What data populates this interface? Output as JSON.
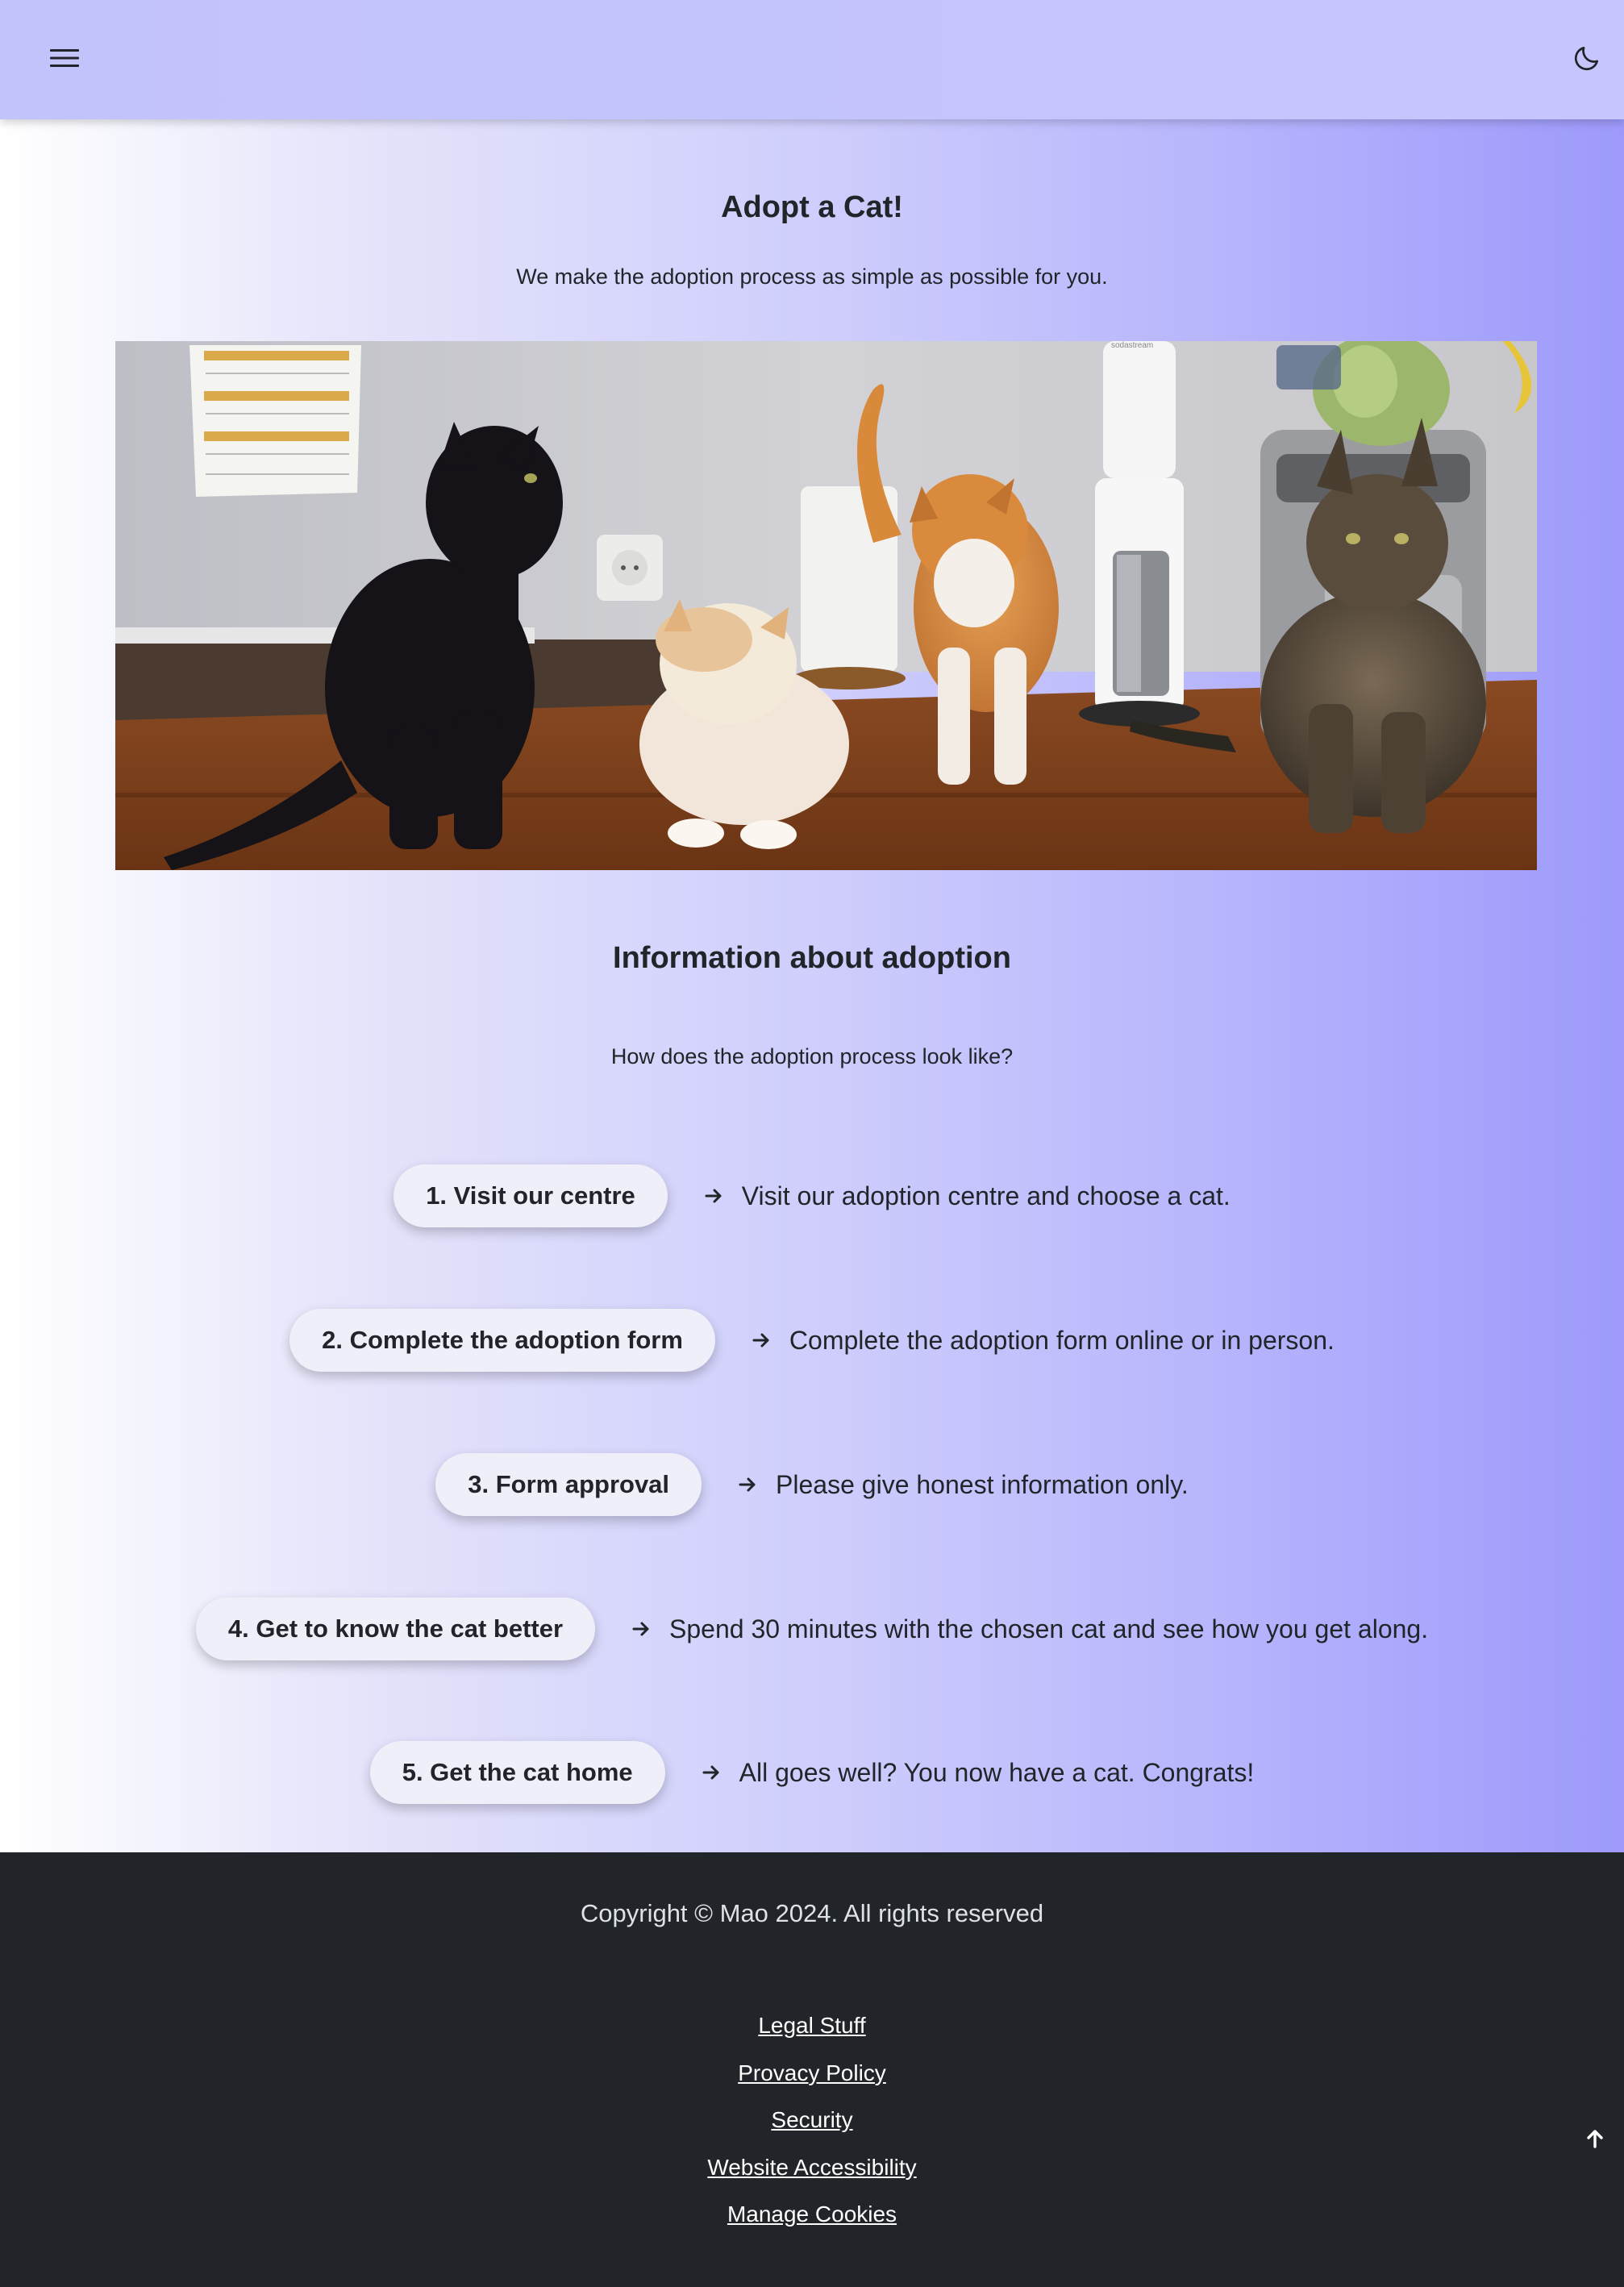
{
  "header": {
    "menu_icon": "hamburger-menu-icon",
    "theme_icon": "moon-icon"
  },
  "hero": {
    "title": "Adopt a Cat!",
    "subtitle": "We make the adoption process as simple as possible for you.",
    "image_alt": "Four cats on a wooden kitchen counter",
    "image_brand_text": "sodastream"
  },
  "info": {
    "title": "Information about adoption",
    "subtitle": "How does the adoption process look like?",
    "steps": [
      {
        "label": "1. Visit our centre",
        "description": "Visit our adoption centre and choose a cat."
      },
      {
        "label": "2. Complete the adoption form",
        "description": "Complete the adoption form online or in person."
      },
      {
        "label": "3. Form approval",
        "description": "Please give honest information only."
      },
      {
        "label": "4. Get to know the cat better",
        "description": "Spend 30 minutes with the chosen cat and see how you get along."
      },
      {
        "label": "5. Get the cat home",
        "description": "All goes well? You now have a cat. Congrats!"
      }
    ]
  },
  "footer": {
    "copyright": "Copyright © Mao 2024. All rights reserved",
    "links": [
      "Legal Stuff",
      "Provacy Policy",
      "Security",
      "Website Accessibility",
      "Manage Cookies"
    ],
    "scroll_top_icon": "arrow-up-icon"
  },
  "colors": {
    "topbar": "#c4c4fc",
    "gradient_end": "#9d9afb",
    "footer_bg": "#212529",
    "pill_bg": "#efeff9"
  }
}
